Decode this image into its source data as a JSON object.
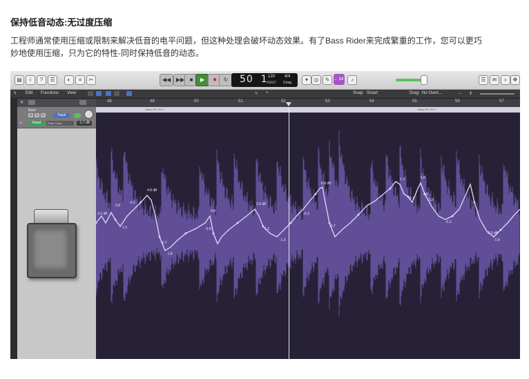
{
  "article": {
    "title": "保持低音动态:无过度压缩",
    "body": "工程师通常使用压缩或限制来解决低音的电平问题，但这种处理会破坏动态效果。有了Bass Rider来完成繁重的工作，您可以更巧妙地使用压缩，只为它的特性-同时保持低音的动态。"
  },
  "daw": {
    "transport": {
      "position_bar": "50",
      "position_beat": "1",
      "tempo": "120",
      "tempo_label": "KEEP",
      "time_sig": "4/4",
      "key": "Cmaj",
      "count_in": "♩34"
    },
    "menus": [
      "Edit",
      "Functions",
      "View"
    ],
    "snap_label": "Snap:",
    "snap_value": "Smart",
    "drag_label": "Drag:",
    "drag_value": "No Overl...",
    "ruler": [
      "48",
      "49",
      "50",
      "51",
      "52",
      "53",
      "54",
      "55",
      "56",
      "57"
    ],
    "region_names": [
      "Bass DE_01.3",
      "Bass DE_01.3"
    ],
    "track": {
      "name": "Bass",
      "mute": "M",
      "solo": "S",
      "record": "R",
      "track_button": "Track",
      "automation_mode": "Read",
      "automation_param": "Rider Fader",
      "automation_value": "-1.7 dB"
    },
    "automation_labels": [
      "3.2 dB",
      "0.8",
      "1.3",
      "-0.3",
      "4.8 dB",
      "-0.7",
      "-1.8",
      "-0.8",
      "0.8",
      "2.6 dB",
      "1.3",
      "-1.3",
      "-0.3",
      "-0.7",
      "6.8 dB",
      "1.3",
      "-0.7",
      "5.8",
      "4.8",
      "5.8",
      "-0.3",
      "-2.5 dB",
      "-1.8"
    ],
    "colors": {
      "wave": "#6b57a8",
      "automation": "#d9d2f3",
      "play": "#4a8a3c",
      "accent": "#a654c6"
    }
  }
}
